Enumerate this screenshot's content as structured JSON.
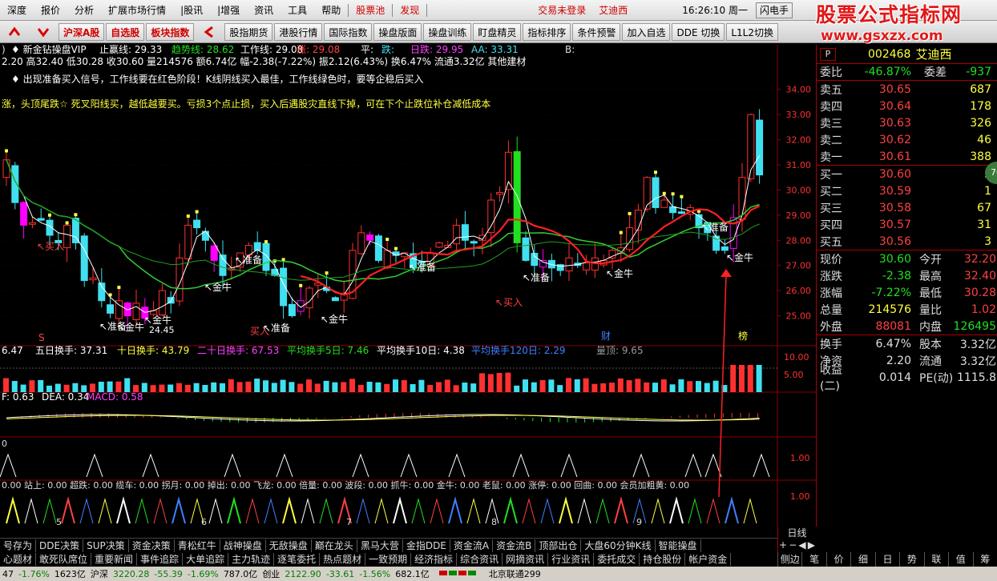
{
  "menu": {
    "items": [
      "深度",
      "报价",
      "分析",
      "扩展市场行情",
      "|股讯",
      "|增强",
      "资讯",
      "工具",
      "帮助"
    ],
    "red_items": [
      "股票池",
      "发现"
    ],
    "trade_status": "交易未登录",
    "stock_name": "艾迪西",
    "time": "16:26:10 周一",
    "flash_label": "闪电手"
  },
  "logo": {
    "line1": "股票公式指标网",
    "line2": "www.gsxzx.com"
  },
  "toolbar": {
    "buttons": [
      "沪深A股",
      "自选股",
      "板块指数",
      "股指期货",
      "港股行情",
      "国际指数",
      "操盘版面",
      "操盘训练",
      "盯盘精灵",
      "指标排序",
      "条件预警",
      "加入自选",
      "DDE 切换",
      "L1L2切换"
    ]
  },
  "chart_info": {
    "line1_left": ")",
    "indicator_name": "新金钻操盘VIP",
    "stop_loss": "止赢线: 29.33",
    "trend": "趋势线: 28.62",
    "work": "工作线: 29.08",
    "rise": "涨: 29.08",
    "flat": "平:",
    "fall": "跌:",
    "day": "日跌: 29.95",
    "aa": "AA: 33.31",
    "b": "B:",
    "line2": "2.20 高32.40 低30.28 收30.60 量214576 额6.74亿 幅-2.38(-7.22%) 振2.12(6.43%) 换6.47% 流通3.32亿 其他建材",
    "note1": "出现准备买入信号，工作线要在红色阶段！K线阴线买入最佳，工作线绿色时，要等企稳后买入",
    "note2": "涨，头顶尾跌☆ 死叉阳线买，越低越要买。亏损3个点止损，买入后遇股灾直线下掉，可在下个止跌位补仓减低成本"
  },
  "price_axis": [
    "34.00",
    "33.00",
    "32.00",
    "31.00",
    "30.00",
    "29.00",
    "28.00",
    "27.00",
    "26.00",
    "25.00"
  ],
  "volume_info": {
    "v0": "6.47",
    "v5": "五日换手: 37.31",
    "v10": "十日换手: 43.79",
    "v20": "二十日换手: 67.53",
    "avg5": "平均换手5日: 7.46",
    "avg10": "平均换手10日: 4.38",
    "avg120": "平均换手120日: 2.29",
    "top": "量顶: 9.65"
  },
  "vol_axis": [
    "10.00",
    "5.00"
  ],
  "macd_info": {
    "dif": "F: 0.63",
    "dea": "DEA: 0.34",
    "macd": "MACD: 0.58"
  },
  "signal_axis": [
    "1.00"
  ],
  "signal2_axis": [
    "1.00"
  ],
  "signal_zero": "0",
  "signal_line": "0.00 站上: 0.00 超跌: 0.00 缆车: 0.00 拐月: 0.00 掉出: 0.00 飞龙: 0.00 倍量: 0.00 波段: 0.00 抓牛: 0.00 金牛: 0.00 老鼠: 0.00 涨停: 0.00 回曲: 0.00 会员加粗黄: 0.00",
  "chart_labels": {
    "buy1": "买入",
    "buy2": "买入",
    "buy3": "买入",
    "jinniu": [
      "金牛",
      "金牛",
      "金牛",
      "金牛",
      "金牛"
    ],
    "zhunbei": [
      "准备",
      "准备",
      "准备",
      "准备",
      "准备",
      "准备"
    ],
    "low_price": "24.45",
    "cai": "财",
    "bang": "榜",
    "s_mark": "S"
  },
  "months": [
    "5",
    "6",
    "7",
    "8",
    "9"
  ],
  "quote": {
    "p_label": "P",
    "code": "002468",
    "name": "艾迪西",
    "weibi_label": "委比",
    "weibi": "-46.87%",
    "weicha_label": "委差",
    "weicha": "-937",
    "asks": [
      {
        "label": "卖五",
        "price": "30.65",
        "vol": "687"
      },
      {
        "label": "卖四",
        "price": "30.64",
        "vol": "178"
      },
      {
        "label": "卖三",
        "price": "30.63",
        "vol": "326"
      },
      {
        "label": "卖二",
        "price": "30.62",
        "vol": "46"
      },
      {
        "label": "卖一",
        "price": "30.61",
        "vol": "388"
      }
    ],
    "bids": [
      {
        "label": "买一",
        "price": "30.60",
        "vol": "3"
      },
      {
        "label": "买二",
        "price": "30.59",
        "vol": "1"
      },
      {
        "label": "买三",
        "price": "30.58",
        "vol": "67"
      },
      {
        "label": "买四",
        "price": "30.57",
        "vol": "31"
      },
      {
        "label": "买五",
        "price": "30.56",
        "vol": "3"
      }
    ],
    "stats": [
      {
        "l1": "现价",
        "v1": "30.60",
        "c1": "green",
        "l2": "今开",
        "v2": "32.20",
        "c2": "red"
      },
      {
        "l1": "涨跌",
        "v1": "-2.38",
        "c1": "green",
        "l2": "最高",
        "v2": "32.40",
        "c2": "red"
      },
      {
        "l1": "涨幅",
        "v1": "-7.22%",
        "c1": "green",
        "l2": "最低",
        "v2": "30.28",
        "c2": "red"
      },
      {
        "l1": "总量",
        "v1": "214576",
        "c1": "yellow",
        "l2": "量比",
        "v2": "1.02",
        "c2": "red"
      },
      {
        "l1": "外盘",
        "v1": "88081",
        "c1": "red",
        "l2": "内盘",
        "v2": "126495",
        "c2": "green"
      }
    ],
    "stats2": [
      {
        "l1": "换手",
        "v1": "6.47%",
        "l2": "股本",
        "v2": "3.32亿"
      },
      {
        "l1": "净资",
        "v1": "2.20",
        "l2": "流通",
        "v2": "3.32亿"
      },
      {
        "l1": "收益(二)",
        "v1": "0.014",
        "l2": "PE(动)",
        "v2": "1115.8"
      }
    ],
    "badge": "70"
  },
  "tabs_row1": [
    "号存为",
    "DDE决策",
    "SUP决策",
    "资金决策",
    "青松红牛",
    "战神操盘",
    "无敌操盘",
    "巅在龙头",
    "黑马大营",
    "金指DDE",
    "资金流A",
    "资金流B",
    "顶部出仓",
    "大盘60分钟K线",
    "智能操盘"
  ],
  "tabs_row2": [
    "心题材",
    "敢死队席位",
    "重要新闻",
    "事件追踪",
    "大单追踪",
    "主力轨迹",
    "逐笔委托",
    "热点题材",
    "一致预期",
    "经济指标",
    "综合资讯",
    "网摘资讯",
    "行业资讯",
    "委托成交",
    "持仓股份",
    "帐户资金"
  ],
  "period_label": "日线",
  "right_tabs": [
    "侧边栏<",
    "笔",
    "价",
    "细",
    "日",
    "势",
    "联",
    "值",
    "筹"
  ],
  "statusbar": {
    "p1": "47",
    "p2": "-1.76%",
    "p3": "1623亿",
    "sh_label": "沪深",
    "sh": "3220.28",
    "sh_ch": "-55.39",
    "sh_pct": "-1.69%",
    "sh_amt": "787.0亿",
    "cy_label": "创业",
    "cy": "2122.90",
    "cy_ch": "-33.61",
    "cy_pct": "-1.56%",
    "cy_amt": "682.1亿",
    "server": "北京联通299"
  },
  "colors": {
    "up": "#ff3030",
    "down": "#40e0f0",
    "bg": "#000000",
    "grid_red": "#8b0000",
    "ma_white": "#ffffff",
    "ma_green": "#32cd32",
    "ma_yellow": "#ffff40",
    "ma_red": "#ff2020",
    "buy_magenta": "#ff00ff"
  }
}
